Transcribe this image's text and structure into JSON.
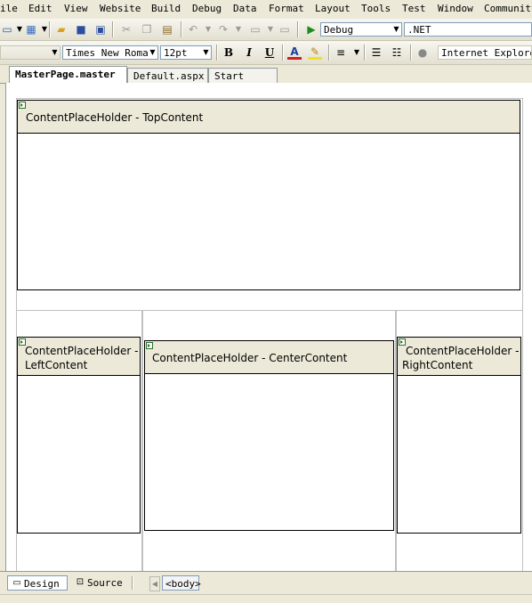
{
  "menu": [
    "ile",
    "Edit",
    "View",
    "Website",
    "Build",
    "Debug",
    "Data",
    "Format",
    "Layout",
    "Tools",
    "Test",
    "Window",
    "Community"
  ],
  "toolbar1": {
    "config_value": "Debug",
    "platform_value": ".NET"
  },
  "toolbar2": {
    "font_value": "Times New Roman",
    "size_value": "12pt",
    "bold": "B",
    "italic": "I",
    "underline": "U",
    "target_value": "Internet Explorer"
  },
  "tabs": [
    "MasterPage.master",
    "Default.aspx",
    "Start Page"
  ],
  "placeholders": {
    "top": "ContentPlaceHolder - TopContent",
    "left_line1": "ContentPlaceHolder -",
    "left_line2": "LeftContent",
    "center": "ContentPlaceHolder - CenterContent",
    "right_line1": "ContentPlaceHolder -",
    "right_line2": "RightContent"
  },
  "bottom": {
    "design": "Design",
    "source": "Source",
    "body_tag": "<body>"
  },
  "colors": {
    "chrome": "#ece9d8",
    "placeholder_header": "#ece9d8",
    "guide_border": "#c0c0c0"
  }
}
